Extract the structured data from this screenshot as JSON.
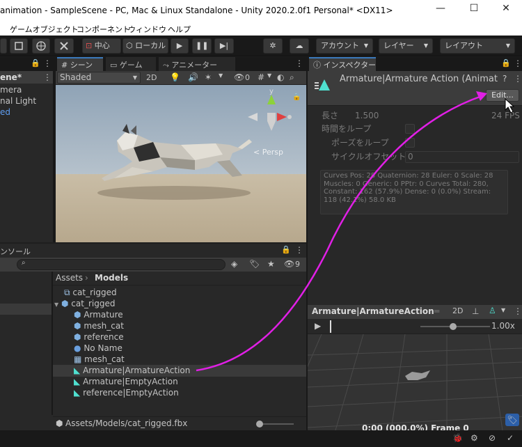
{
  "window": {
    "title": "animation - SampleScene - PC, Mac & Linux Standalone - Unity 2020.2.0f1 Personal* <DX11>",
    "minimize": "—",
    "maximize": "☐",
    "close": "✕"
  },
  "menu": [
    "ゲームオブジェクト",
    "コンポーネント",
    "ウィンドウ",
    "ヘルプ"
  ],
  "toolbar": {
    "pivot_label": "中心",
    "global_label": "ローカル",
    "account_label": "アカウント",
    "layers_label": "レイヤー",
    "layout_label": "レイアウト"
  },
  "hierarchy": {
    "scene": "ene*",
    "items": [
      "mera",
      "nal Light",
      "ed"
    ]
  },
  "scene_view": {
    "tabs": [
      "シーン",
      "ゲーム",
      "アニメーター"
    ],
    "shading": "Shaded",
    "mode_2d": "2D",
    "hidden_count": "0",
    "persp_label": "< Persp",
    "axis_y": "y"
  },
  "project": {
    "tab_label": "ンソール",
    "search_placeholder": "",
    "hidden_count": "9",
    "breadcrumb_root": "Assets",
    "breadcrumb_current": "Models",
    "items": [
      "cat_rigged",
      "cat_rigged",
      "Armature",
      "mesh_cat",
      "reference",
      "No Name",
      "mesh_cat",
      "Armature|ArmatureAction",
      "Armature|EmptyAction",
      "reference|EmptyAction"
    ],
    "footer_path": "Assets/Models/cat_rigged.fbx"
  },
  "inspector": {
    "tab_label": "インスペクター",
    "title": "Armature|Armature Action (Animat",
    "edit_button": "Edit...",
    "length_label": "長さ",
    "length_value": "1.500",
    "fps": "24 FPS",
    "loop_time": "時間をループ",
    "loop_pose": "ポーズをループ",
    "cycle_offset": "サイクルオフセット",
    "cycle_offset_value": "0",
    "stats": "Curves Pos: 28 Quaternion: 28 Euler: 0 Scale: 28 Muscles: 0 Generic: 0 PPtr: 0 Curves Total: 280, Constant: 162 (57.9%) Dense: 0 (0.0%) Stream: 118 (42.1%) 58.0 KB"
  },
  "preview": {
    "title": "Armature|ArmatureAction",
    "mode_2d": "2D",
    "speed": "1.00x",
    "timecode": "0:00 (000.0%) Frame 0"
  },
  "colors": {
    "arrow": "#e11fe6",
    "accent": "#3a79bb",
    "sky": "#a9b8c7",
    "ground": "#c6b79f"
  }
}
